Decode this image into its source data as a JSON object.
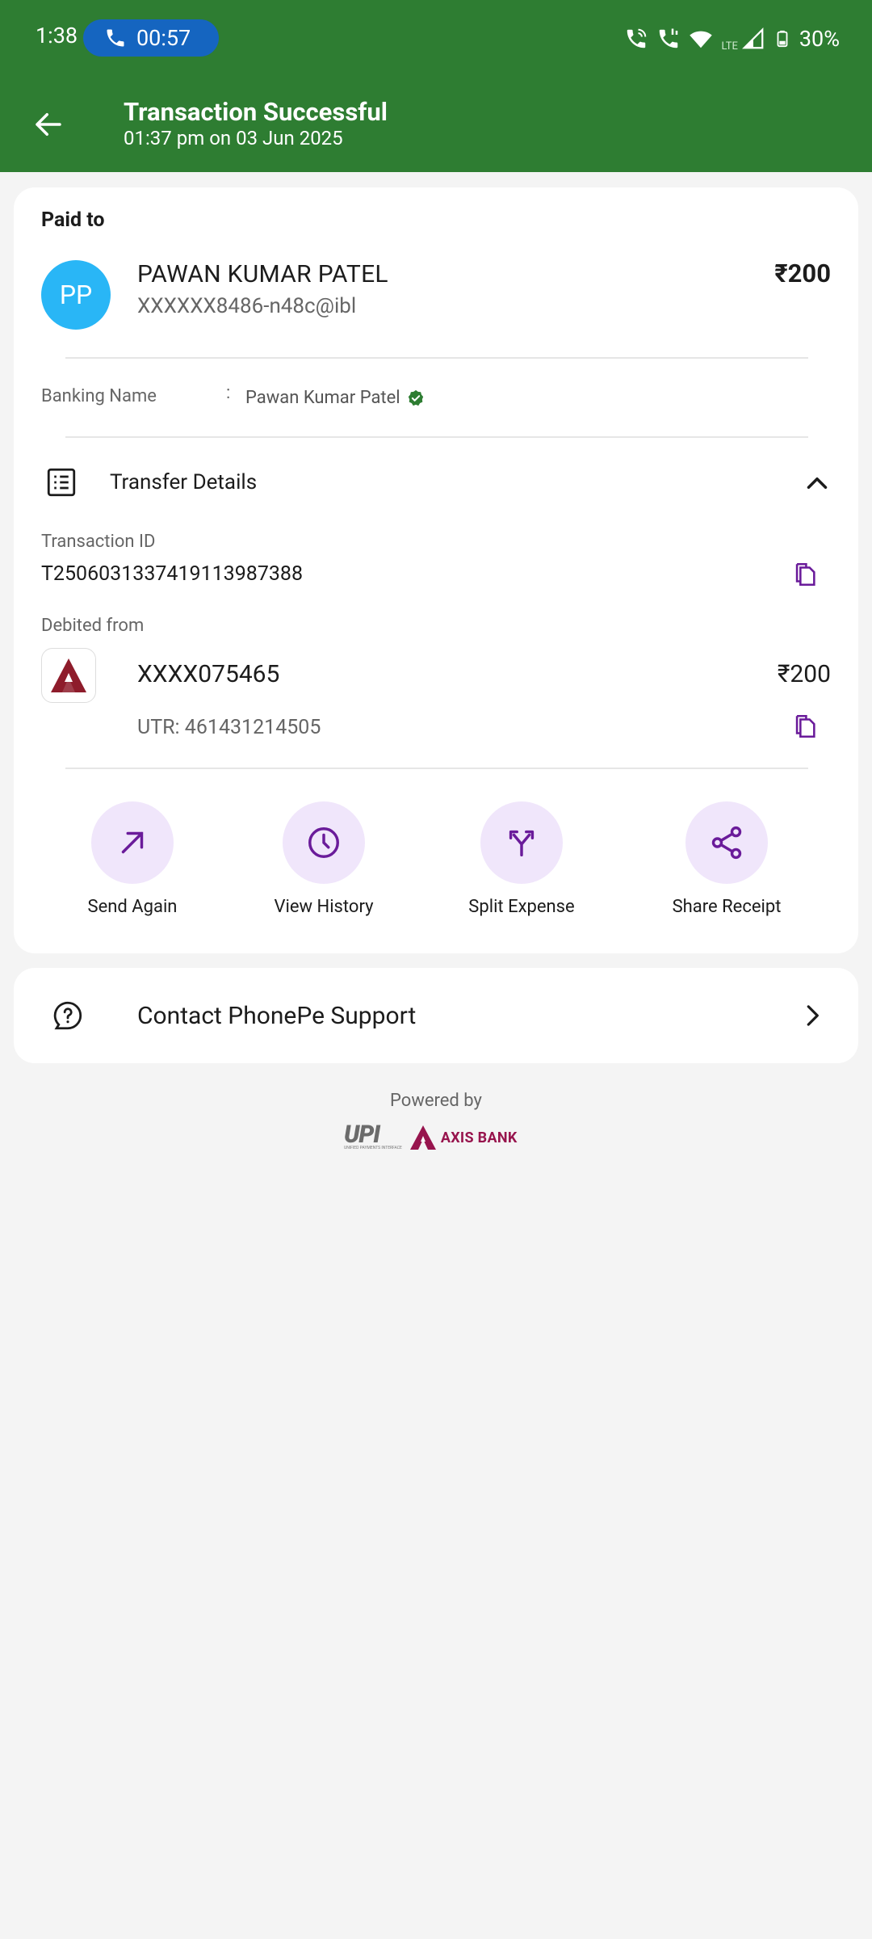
{
  "status_bar": {
    "time": "1:38",
    "call_timer": "00:57",
    "battery": "30%",
    "network_type": "LTE"
  },
  "header": {
    "title": "Transaction Successful",
    "subtitle": "01:37 pm on 03 Jun 2025",
    "background_color": "#2e7d32"
  },
  "payee": {
    "section_label": "Paid to",
    "initials": "PP",
    "name": "PAWAN KUMAR PATEL",
    "vpa": "XXXXXX8486-n48c@ibl",
    "amount": "₹200"
  },
  "banking": {
    "label": "Banking Name",
    "separator": ":",
    "value": "Pawan Kumar Patel"
  },
  "transfer_details": {
    "label": "Transfer Details",
    "transaction_id_label": "Transaction ID",
    "transaction_id": "T2506031337419113987388",
    "debited_from_label": "Debited from",
    "account": "XXXX075465",
    "amount": "₹200",
    "utr": "UTR: 461431214505"
  },
  "actions": [
    {
      "label": "Send Again",
      "icon": "arrow-up-right-icon"
    },
    {
      "label": "View History",
      "icon": "clock-icon"
    },
    {
      "label": "Split Expense",
      "icon": "split-icon"
    },
    {
      "label": "Share Receipt",
      "icon": "share-icon"
    }
  ],
  "support": {
    "label": "Contact PhonePe Support"
  },
  "footer": {
    "powered_by": "Powered by",
    "upi_text": "UPI",
    "upi_sub": "UNIFIED PAYMENTS INTERFACE",
    "bank_text": "AXIS BANK"
  },
  "colors": {
    "accent_purple": "#6a1b9a",
    "action_bg": "#f0e6fb",
    "verified_green": "#2e7d32",
    "avatar_blue": "#29b6f6",
    "axis_maroon": "#97144d"
  }
}
